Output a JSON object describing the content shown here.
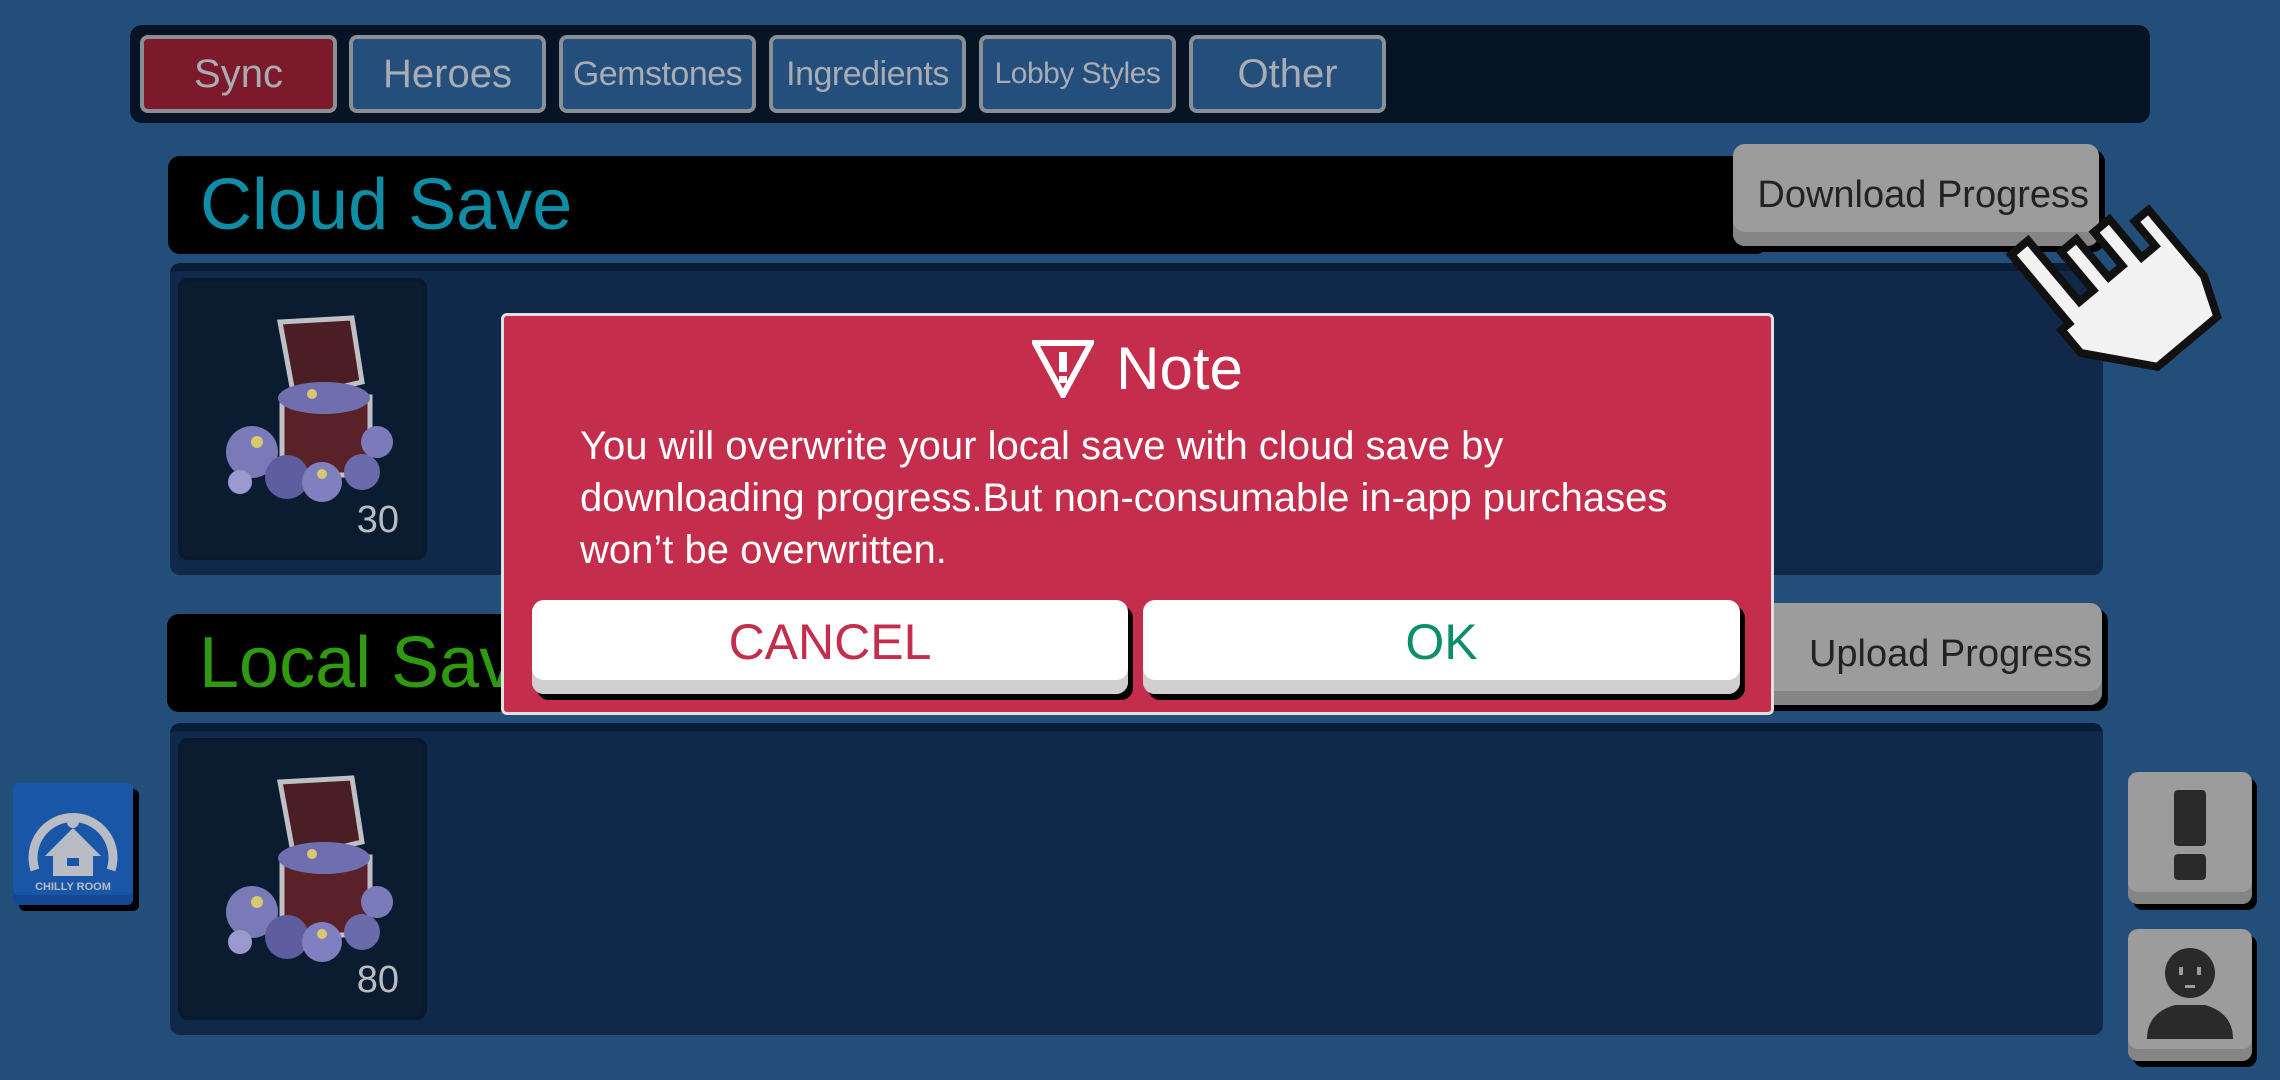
{
  "tabs": [
    {
      "label": "Sync",
      "active": true
    },
    {
      "label": "Heroes",
      "active": false
    },
    {
      "label": "Gemstones",
      "active": false
    },
    {
      "label": "Ingredients",
      "active": false
    },
    {
      "label": "Lobby Styles",
      "active": false
    },
    {
      "label": "Other",
      "active": false
    }
  ],
  "cloud": {
    "title": "Cloud Save",
    "title_color": "#0e8ea6",
    "button_label": "Download Progress",
    "item": {
      "icon": "gem-chest-icon",
      "count": "30"
    }
  },
  "local": {
    "title": "Local Save",
    "title_color": "#2f9a10",
    "button_label": "Upload Progress",
    "item": {
      "icon": "gem-chest-icon",
      "count": "80"
    }
  },
  "side": {
    "logo_text": "CHILLY ROOM",
    "notice_icon": "exclamation-icon",
    "profile_icon": "person-icon"
  },
  "dialog": {
    "title": "Note",
    "icon": "warning-triangle-icon",
    "message": "You will overwrite your local save with cloud save by downloading progress.But non-consumable in-app purchases won’t be overwritten.",
    "cancel_label": "CANCEL",
    "ok_label": "OK",
    "cancel_color": "#c42d4b",
    "ok_color": "#0b8f6b"
  }
}
